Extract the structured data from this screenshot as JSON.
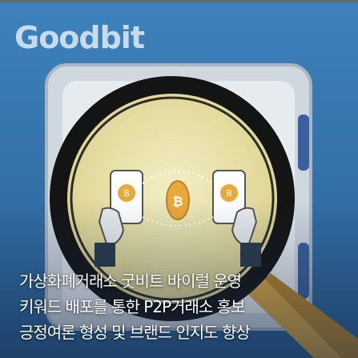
{
  "logo": {
    "text": "Goodbit"
  },
  "caption": {
    "lines": [
      "가상화폐거래소 굿비트 바이럴 운영",
      "키워드 배포를 통한 P2P거래소 홍보",
      "긍정여론 형성 및 브랜드 인지도 향상"
    ]
  },
  "colors": {
    "background": "#2f6fa8",
    "lens_ring": "#141414",
    "lens_glass": "#e9e2a6",
    "handle": "#d9a53f",
    "coin": "#e8a93a",
    "border": "#5f6a74"
  },
  "icons": [
    "magnifying-glass-icon",
    "smartphone-icon",
    "bitcoin-coin-icon",
    "hand-icon",
    "safe-vault-icon"
  ]
}
